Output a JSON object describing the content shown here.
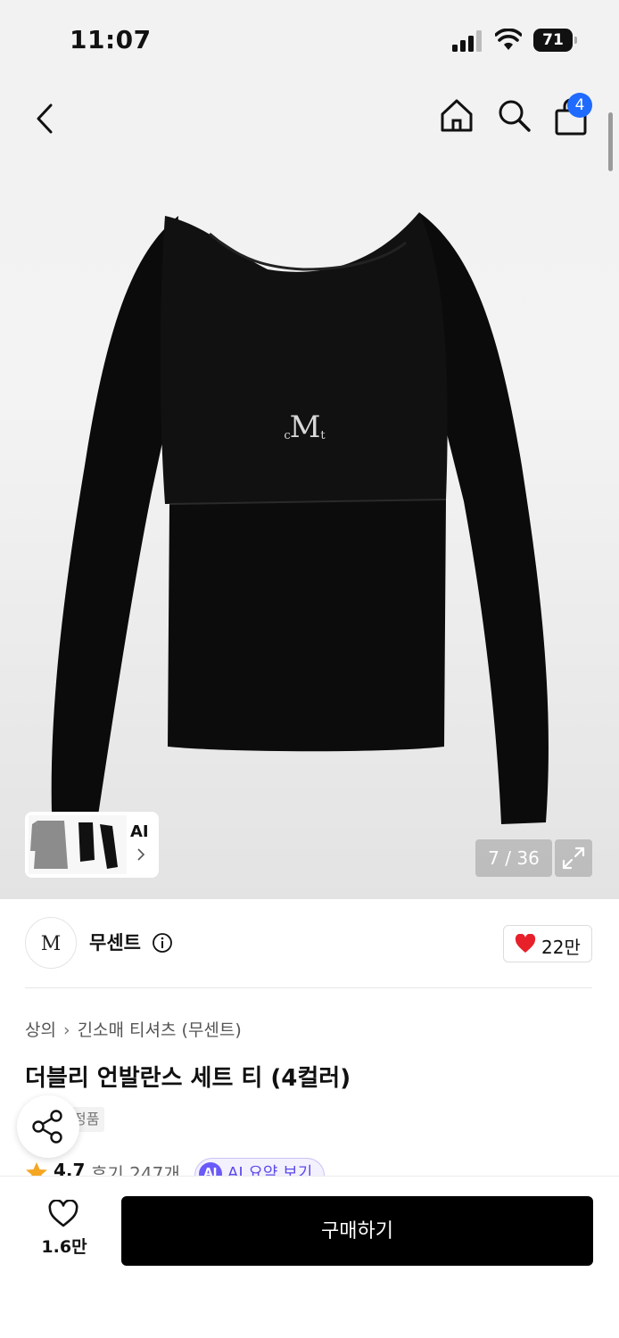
{
  "status_bar": {
    "time": "11:07",
    "battery": "71"
  },
  "header": {
    "cart_badge": "4"
  },
  "gallery": {
    "ai_label": "AI",
    "page_counter": "7 / 36"
  },
  "brand": {
    "name": "무센트",
    "logo_text": "M",
    "likes": "22만"
  },
  "product": {
    "breadcrumb": [
      "상의",
      "긴소매 티셔츠 (무센트)"
    ],
    "title": "더블리 언발란스 세트 티 (4컬러)",
    "badge": "정품",
    "rating": "4.7",
    "reviews": "후기 247개",
    "ai_summary_badge": "AI",
    "ai_summary": "AI 요약 보기"
  },
  "bottom_bar": {
    "wish_count": "1.6만",
    "buy_label": "구매하기"
  },
  "colors": {
    "accent_blue": "#1f6bff",
    "heart_red": "#e8202a",
    "star_orange": "#f5a623",
    "ai_purple": "#6a5af9"
  }
}
